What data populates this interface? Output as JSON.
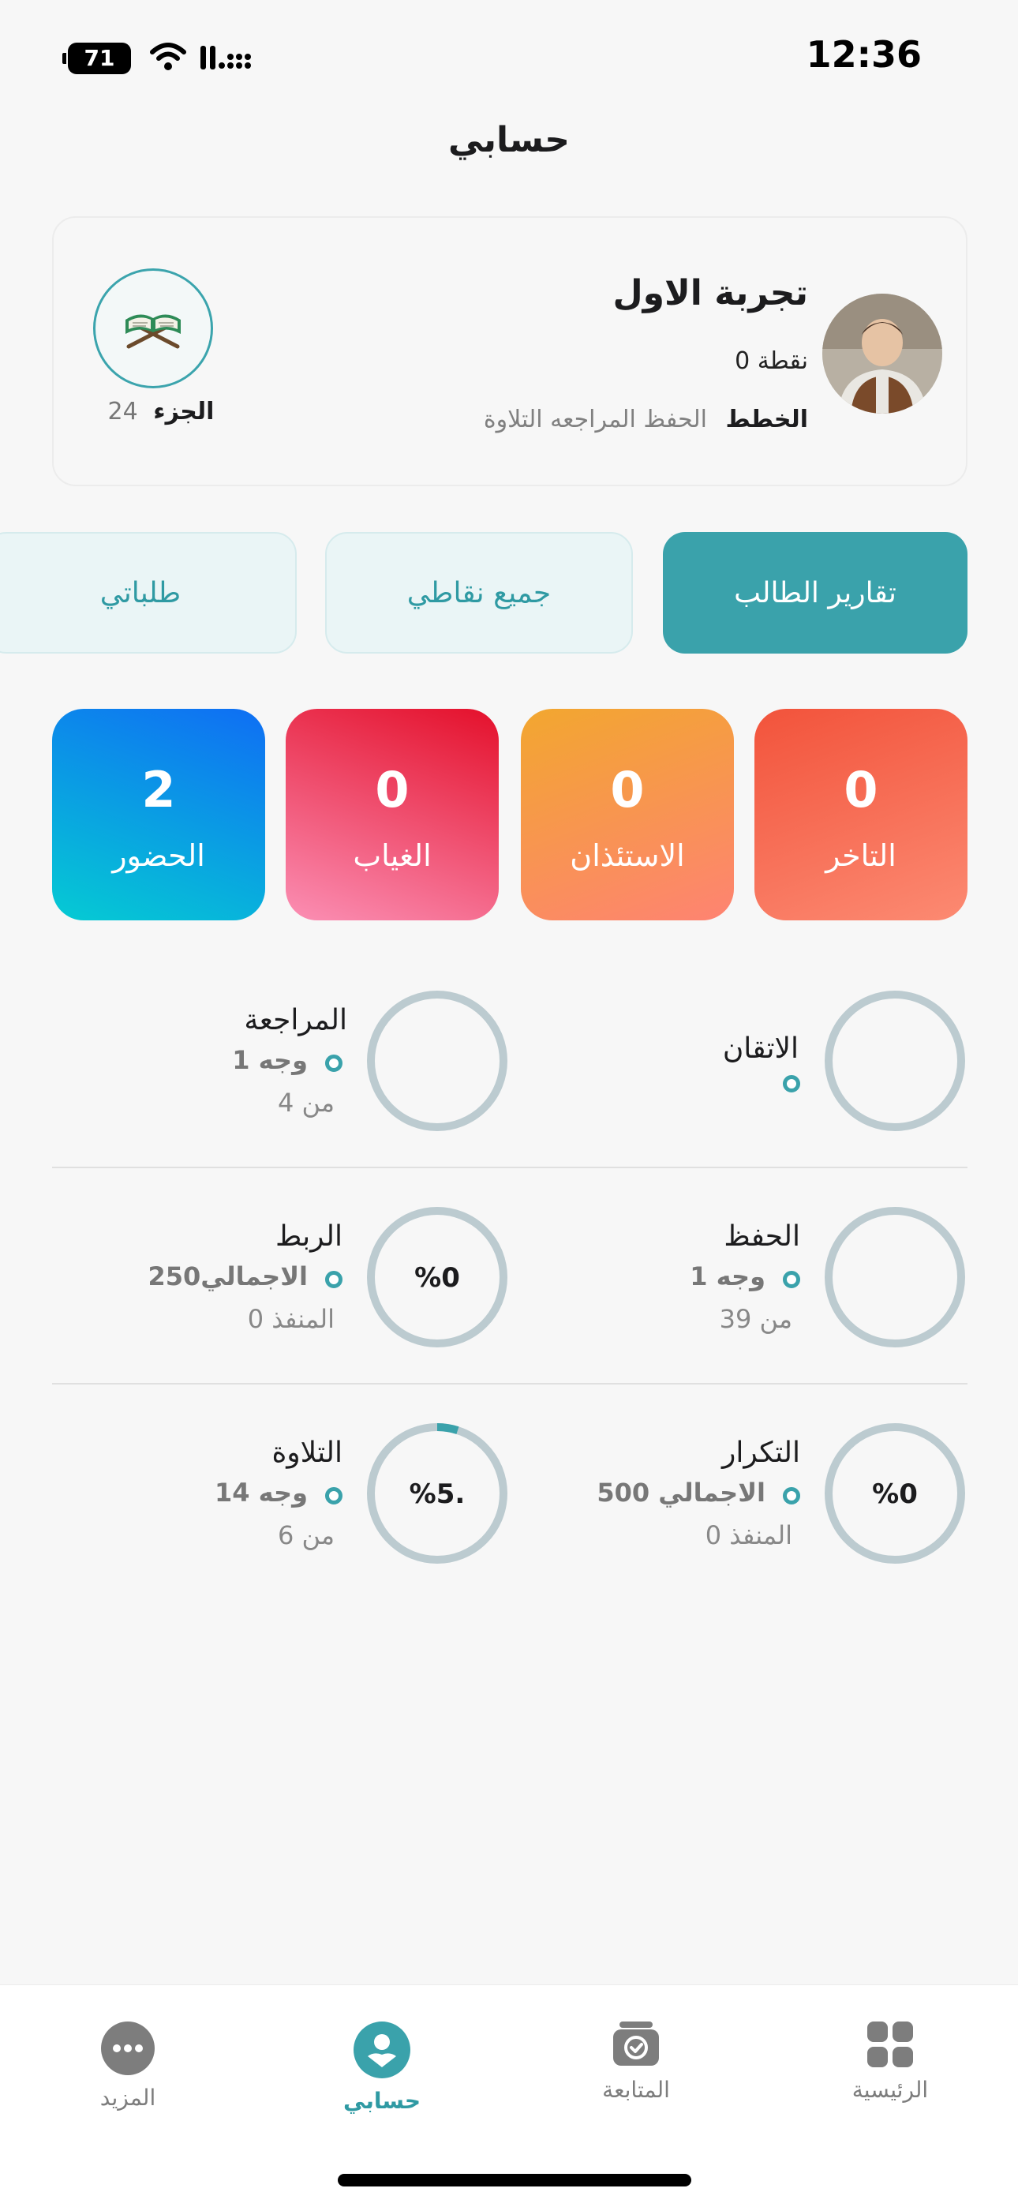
{
  "status_bar": {
    "time": "12:36",
    "battery": "71"
  },
  "header": {
    "title": "حسابي"
  },
  "profile": {
    "name": "تجربة الاول",
    "points": "نقطة 0",
    "plans_label": "الخطط",
    "plans_value": "الحفظ المراجعه التلاوة",
    "part_label": "الجزء",
    "part_value": "24"
  },
  "tabs": [
    {
      "label": "تقارير الطالب",
      "active": true
    },
    {
      "label": "جميع نقاطي",
      "active": false
    },
    {
      "label": "طلباتي",
      "active": false
    }
  ],
  "stats": [
    {
      "label": "التاخر",
      "value": "0"
    },
    {
      "label": "الاستئذان",
      "value": "0"
    },
    {
      "label": "الغياب",
      "value": "0"
    },
    {
      "label": "الحضور",
      "value": "2"
    }
  ],
  "progress": {
    "mastery": {
      "label": "الاتقان",
      "percent_text": "",
      "progress": 0
    },
    "review": {
      "label": "المراجعة",
      "percent_text": "",
      "progress": 0,
      "detail": "وجه 1",
      "from": "من 4"
    },
    "memorization": {
      "label": "الحفظ",
      "percent_text": "",
      "progress": 0,
      "detail": "وجه 1",
      "from": "من 39"
    },
    "linking": {
      "label": "الربط",
      "percent_text": "%0",
      "progress": 0,
      "detail": "الاجمالي250",
      "from": "المنفذ 0"
    },
    "repetition": {
      "label": "التكرار",
      "percent_text": "%0",
      "progress": 0,
      "detail": "الاجمالي 500",
      "from": "المنفذ 0"
    },
    "recitation": {
      "label": "التلاوة",
      "percent_text": "%5.",
      "progress": 0.05,
      "detail": "وجه 14",
      "from": "من 6"
    }
  },
  "colors": {
    "accent": "#3aa2ab",
    "ring_track": "#bccbd0"
  },
  "bottom_nav": [
    {
      "label": "الرئيسية",
      "icon": "grid-icon",
      "active": false
    },
    {
      "label": "المتابعة",
      "icon": "tracking-icon",
      "active": false
    },
    {
      "label": "حسابي",
      "icon": "profile-icon",
      "active": true
    },
    {
      "label": "المزيد",
      "icon": "more-icon",
      "active": false
    }
  ]
}
